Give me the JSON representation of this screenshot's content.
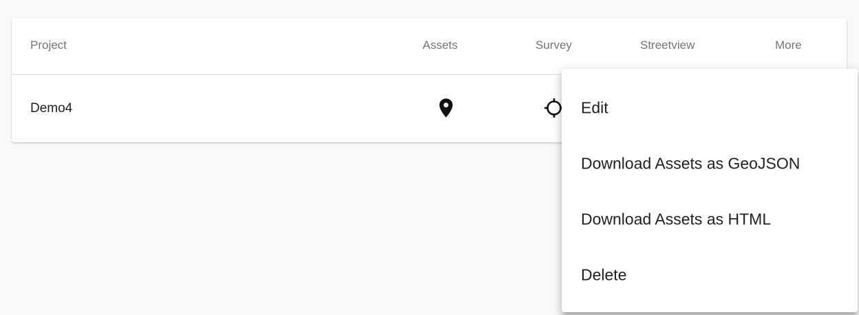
{
  "table": {
    "headers": {
      "project": "Project",
      "assets": "Assets",
      "survey": "Survey",
      "streetview": "Streetview",
      "more": "More"
    },
    "rows": [
      {
        "project": "Demo4",
        "assets_icon": "location-pin-icon",
        "survey_icon": "crosshair-icon"
      }
    ]
  },
  "menu": {
    "items": [
      {
        "label": "Edit"
      },
      {
        "label": "Download Assets as GeoJSON"
      },
      {
        "label": "Download Assets as HTML"
      },
      {
        "label": "Delete"
      }
    ]
  },
  "colors": {
    "background": "#f9f9f9",
    "header_text": "#757575",
    "text": "#212121"
  }
}
